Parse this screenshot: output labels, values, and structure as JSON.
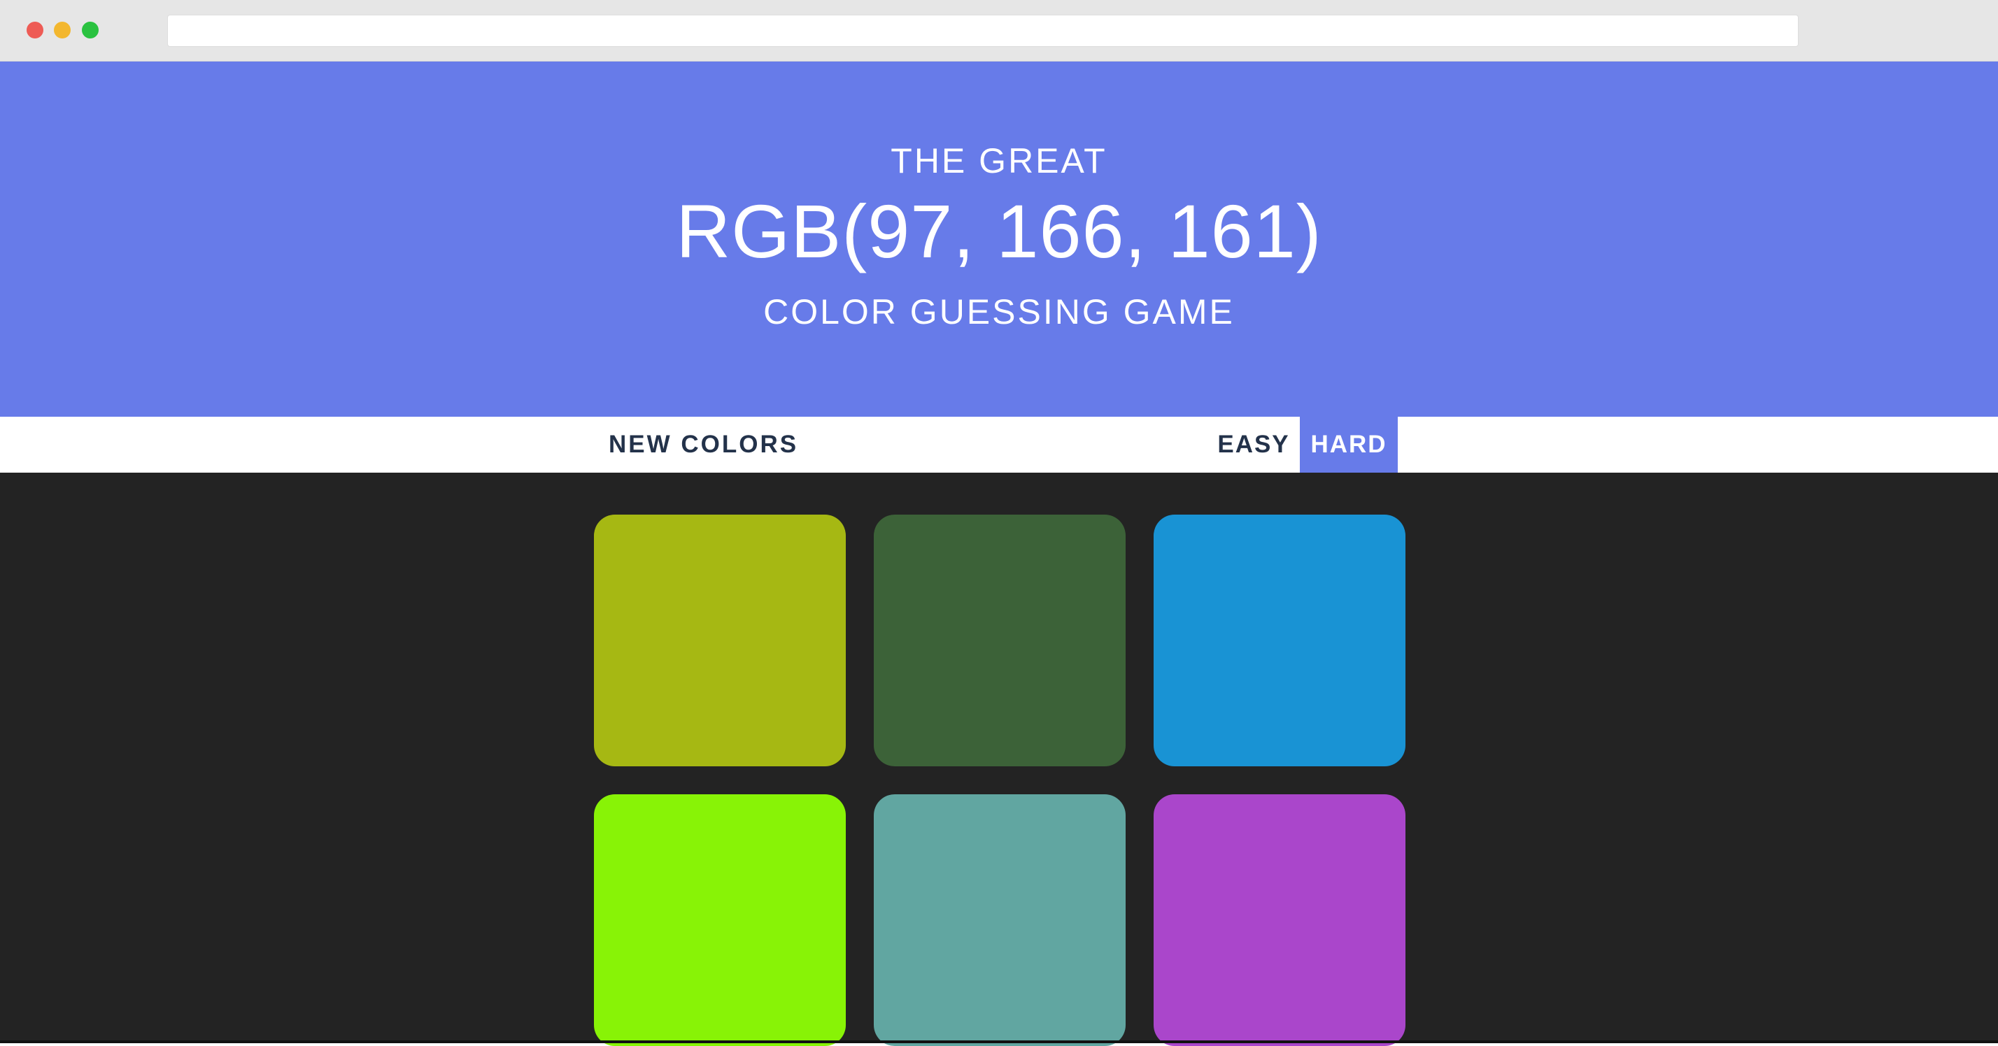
{
  "header": {
    "line1": "THE GREAT",
    "target_color": "RGB(97, 166, 161)",
    "line3": "COLOR GUESSING GAME"
  },
  "controls": {
    "new_colors_label": "NEW COLORS",
    "easy_label": "EASY",
    "hard_label": "HARD",
    "selected_mode": "HARD"
  },
  "colors": {
    "accent": "#677be9",
    "background": "#232323",
    "text_dark": "#23324a"
  },
  "squares": [
    {
      "color": "#a6b813"
    },
    {
      "color": "#3c6238"
    },
    {
      "color": "#1993d4"
    },
    {
      "color": "#88f306"
    },
    {
      "color": "#61a6a1"
    },
    {
      "color": "#aa46cb"
    }
  ]
}
